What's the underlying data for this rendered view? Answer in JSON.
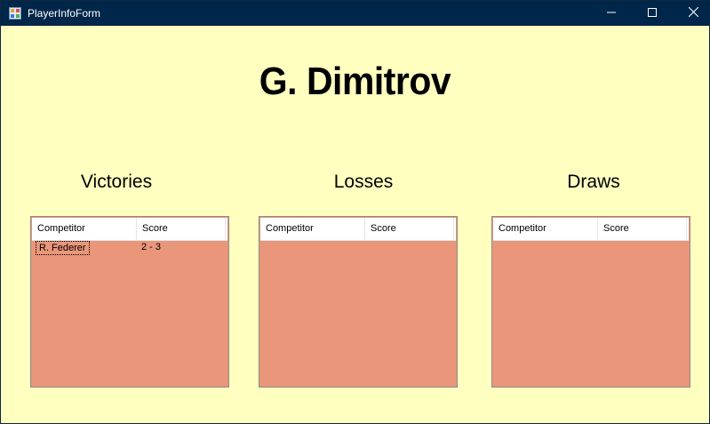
{
  "window": {
    "title": "PlayerInfoForm"
  },
  "player": {
    "name": "G. Dimitrov"
  },
  "sections": {
    "victories": {
      "label": "Victories",
      "columns": [
        "Competitor",
        "Score"
      ],
      "rows": [
        {
          "competitor": "R. Federer",
          "score": "2 - 3"
        }
      ]
    },
    "losses": {
      "label": "Losses",
      "columns": [
        "Competitor",
        "Score"
      ],
      "rows": []
    },
    "draws": {
      "label": "Draws",
      "columns": [
        "Competitor",
        "Score"
      ],
      "rows": []
    }
  },
  "colors": {
    "form_background": "#ffffc0",
    "list_background": "#e9967a",
    "titlebar": "#00264a"
  },
  "icons": {
    "app": "app-form-icon",
    "minimize": "minimize-icon",
    "maximize": "maximize-icon",
    "close": "close-icon"
  }
}
